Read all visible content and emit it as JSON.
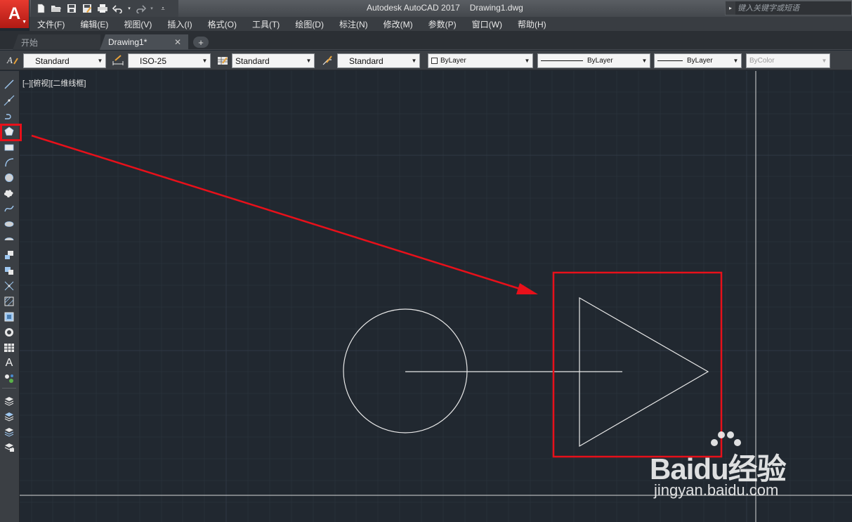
{
  "app": {
    "logo_letter": "A",
    "title": "Autodesk AutoCAD 2017",
    "filename": "Drawing1.dwg",
    "search_placeholder": "键入关键字或短语"
  },
  "menu": [
    "文件(F)",
    "编辑(E)",
    "视图(V)",
    "插入(I)",
    "格式(O)",
    "工具(T)",
    "绘图(D)",
    "标注(N)",
    "修改(M)",
    "参数(P)",
    "窗口(W)",
    "帮助(H)"
  ],
  "tabs": {
    "start": "开始",
    "drawing": "Drawing1*",
    "close_glyph": "✕",
    "add_glyph": "+"
  },
  "properties_toolbar": {
    "text_style": "Standard",
    "dim_style": "ISO-25",
    "table_style": "Standard",
    "multileader_style": "Standard",
    "color": "ByLayer",
    "linetype": "ByLayer",
    "lineweight": "ByLayer",
    "plot_style": "ByColor"
  },
  "draw_toolbar_icons": [
    "line-icon",
    "construction-line-icon",
    "polyline-icon",
    "polygon-icon",
    "rectangle-icon",
    "arc-icon",
    "circle-icon",
    "revision-cloud-icon",
    "spline-icon",
    "ellipse-icon",
    "ellipse-arc-icon",
    "insert-block-icon",
    "make-block-icon",
    "point-icon",
    "hatch-icon",
    "gradient-icon",
    "region-icon",
    "table-icon",
    "mtext-icon",
    "add-selected-icon",
    "layer-icon-1",
    "layer-icon-2",
    "layer-icon-3",
    "layer-icon-4"
  ],
  "canvas": {
    "viewport_label": "[–][俯视][二维线框]"
  },
  "watermark": {
    "brand": "Baidu经验",
    "url": "jingyan.baidu.com"
  },
  "colors": {
    "canvas_bg": "#212830",
    "annotation_red": "#e8101a",
    "geometry": "#e8e8e8",
    "logo_red": "#d42a20"
  }
}
